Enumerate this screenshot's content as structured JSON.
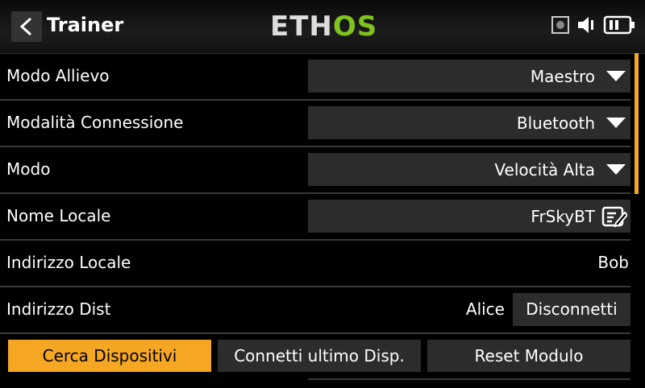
{
  "header": {
    "title": "Trainer",
    "logo_left": "ETH",
    "logo_right": "OS"
  },
  "rows": [
    {
      "label": "Modo Allievo",
      "value": "Maestro"
    },
    {
      "label": "Modalità Connessione",
      "value": "Bluetooth"
    },
    {
      "label": "Modo",
      "value": "Velocità Alta"
    },
    {
      "label": "Nome Locale",
      "value": "FrSkyBT"
    },
    {
      "label": "Indirizzo Locale",
      "value": "Bob"
    },
    {
      "label": "Indirizzo Dist",
      "value": "Alice",
      "button": "Disconnetti"
    }
  ],
  "buttons": {
    "search": "Cerca Dispositivi",
    "connect_last": "Connetti ultimo Disp.",
    "reset": "Reset Modulo"
  },
  "colors": {
    "accent": "#f5a623",
    "logo_green": "#7fc31e",
    "field_bg": "#2c2c2c"
  }
}
